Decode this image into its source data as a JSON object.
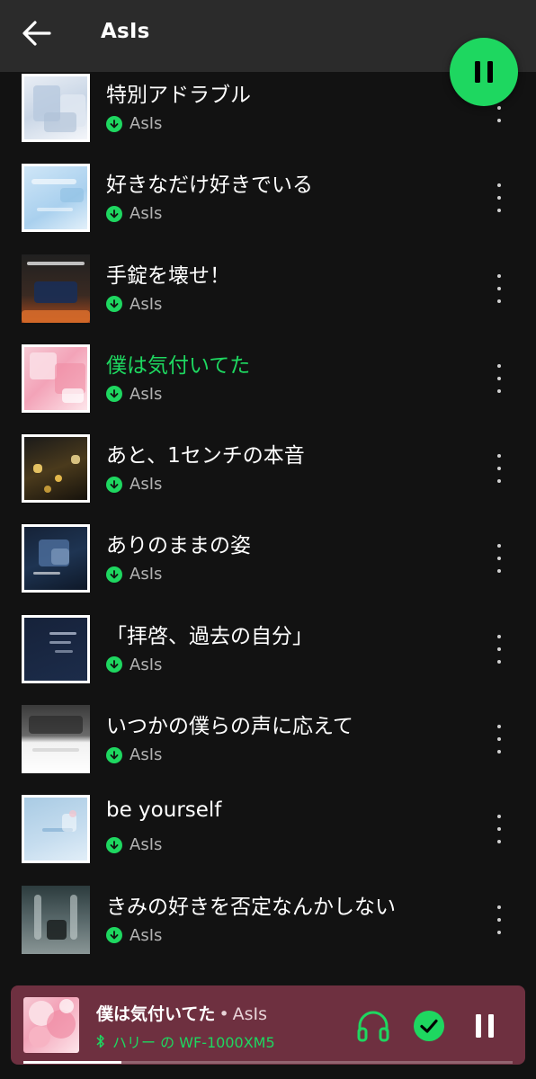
{
  "header": {
    "title": "AsIs",
    "back_icon": "arrow-left-icon",
    "play_state": "pause-icon",
    "accent": "#1ed760"
  },
  "tracks": [
    {
      "title": "特別アドラブル",
      "artist": "AsIs",
      "playing": false,
      "downloaded": true
    },
    {
      "title": "好きなだけ好きでいる",
      "artist": "AsIs",
      "playing": false,
      "downloaded": true
    },
    {
      "title": "手錠を壊せ！",
      "artist": "AsIs",
      "playing": false,
      "downloaded": true
    },
    {
      "title": "僕は気付いてた",
      "artist": "AsIs",
      "playing": true,
      "downloaded": true
    },
    {
      "title": "あと、1センチの本音",
      "artist": "AsIs",
      "playing": false,
      "downloaded": true
    },
    {
      "title": "ありのままの姿",
      "artist": "AsIs",
      "playing": false,
      "downloaded": true
    },
    {
      "title": "「拝啓、過去の自分」",
      "artist": "AsIs",
      "playing": false,
      "downloaded": true
    },
    {
      "title": "いつかの僕らの声に応えて",
      "artist": "AsIs",
      "playing": false,
      "downloaded": true
    },
    {
      "title": "be yourself",
      "artist": "AsIs",
      "playing": false,
      "downloaded": true
    },
    {
      "title": "きみの好きを否定なんかしない",
      "artist": "AsIs",
      "playing": false,
      "downloaded": true
    }
  ],
  "mini_player": {
    "title": "僕は気付いてた",
    "separator": "•",
    "artist": "AsIs",
    "device": "ハリー の WF-1000XM5",
    "device_icon": "bluetooth-icon",
    "progress": 0.2,
    "background": "#6e3040"
  }
}
